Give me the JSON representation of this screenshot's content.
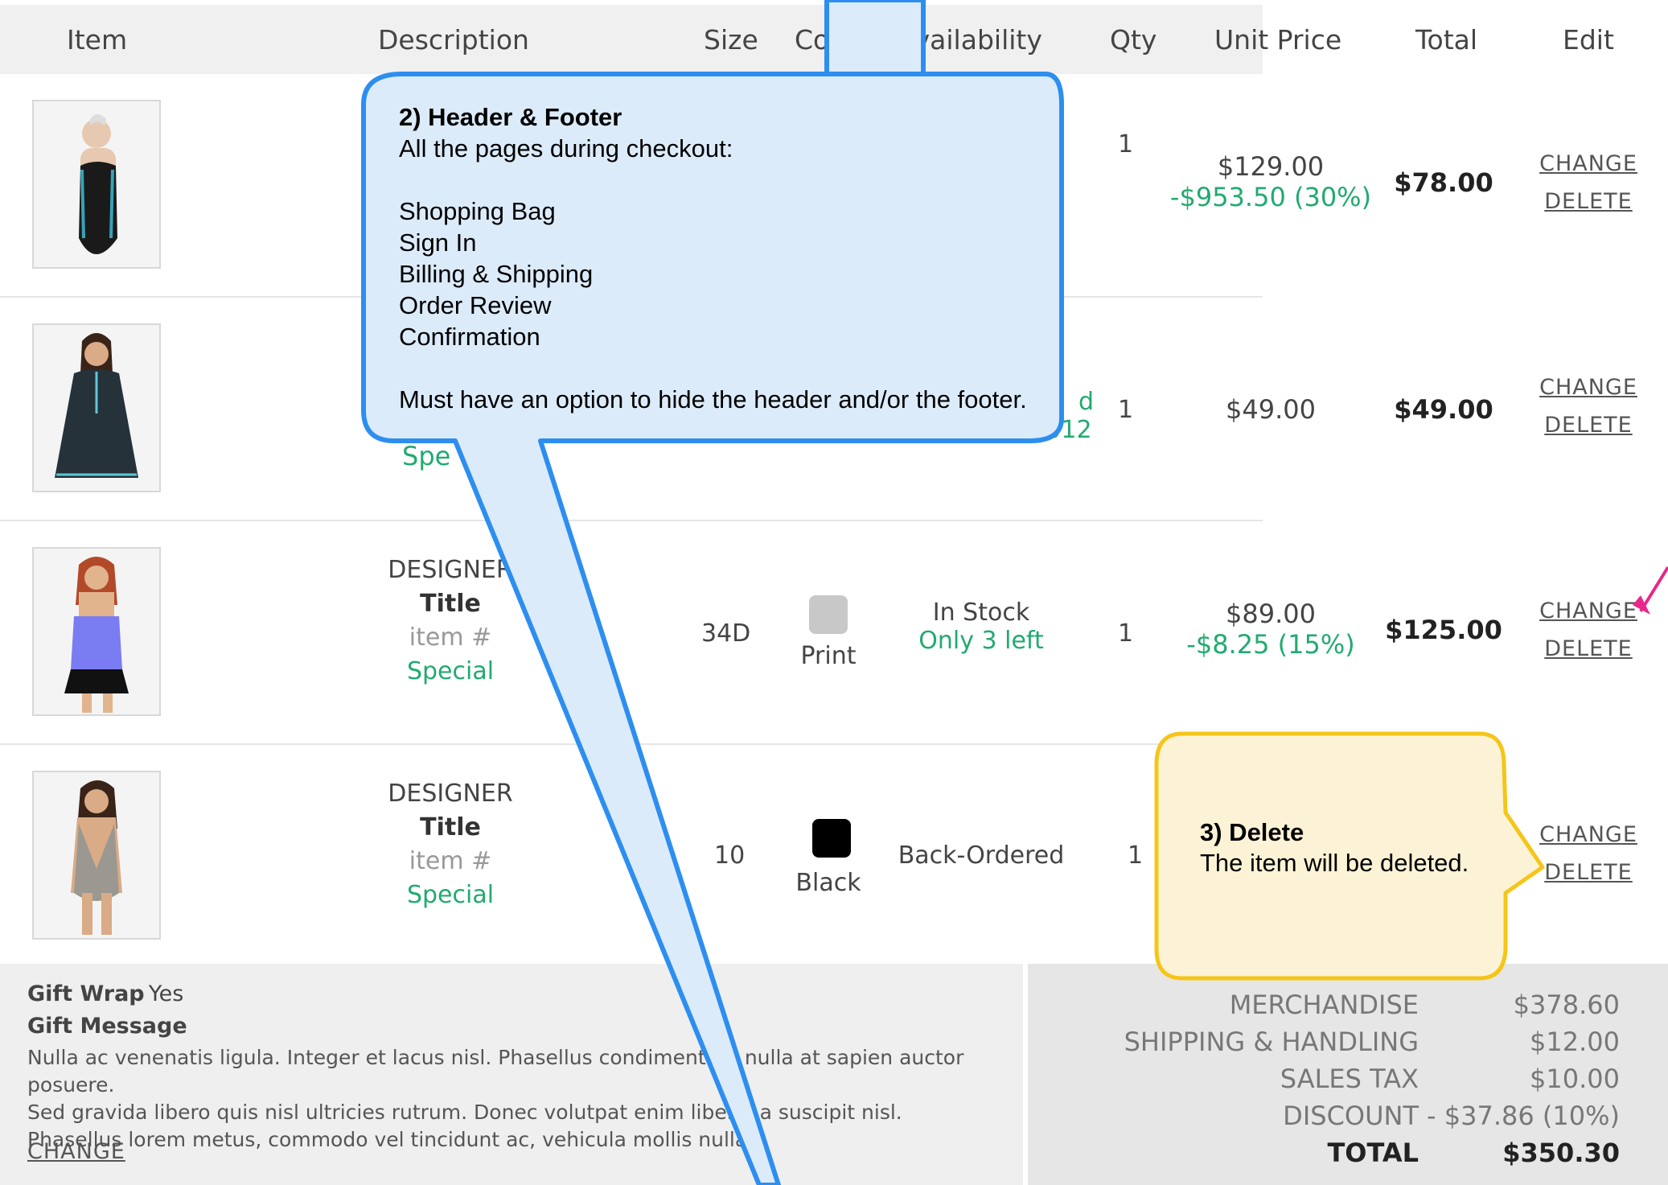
{
  "columns": [
    "Item",
    "Description",
    "Size",
    "Color",
    "Availability",
    "Qty",
    "Unit Price",
    "Total",
    "Edit"
  ],
  "rows": [
    {
      "designer": "",
      "title": "",
      "item_no": "",
      "special": "",
      "size": "",
      "color_name": "",
      "availability": "",
      "availability_note": "",
      "qty": "1",
      "unit_price": "$129.00",
      "discount": "-$953.50 (30%)",
      "total": "$78.00",
      "change": "CHANGE",
      "delete": "DELETE"
    },
    {
      "designer": "",
      "title": "",
      "item_no": "",
      "special": "Spe",
      "size": "",
      "color_name": "",
      "availability": "d",
      "availability_note": "On 11/11/2012",
      "qty": "1",
      "unit_price": "$49.00",
      "discount": "",
      "total": "$49.00",
      "change": "CHANGE",
      "delete": "DELETE"
    },
    {
      "designer": "DESIGNER",
      "title": "Title",
      "item_no": "item #",
      "special": "Special",
      "size": "34D",
      "color_name": "Print",
      "swatch": "#c8c8c8",
      "availability": "In Stock",
      "availability_note": "Only 3 left",
      "qty": "1",
      "unit_price": "$89.00",
      "discount": "-$8.25 (15%)",
      "total": "$125.00",
      "change": "CHANGE",
      "delete": "DELETE"
    },
    {
      "designer": "DESIGNER",
      "title": "Title",
      "item_no": "item #",
      "special": "Special",
      "size": "10",
      "color_name": "Black",
      "swatch": "#000000",
      "availability": "Back-Ordered",
      "availability_note": "",
      "qty": "1",
      "unit_price": "",
      "discount": "",
      "total": "",
      "change": "CHANGE",
      "delete": "DELETE"
    }
  ],
  "gift": {
    "wrap_label": "Gift Wrap",
    "wrap_value": "Yes",
    "message_label": "Gift Message",
    "message_lines": [
      "Nulla ac venenatis ligula. Integer et lacus nisl. Phasellus condimentum nulla at sapien auctor posuere.",
      "Sed gravida libero quis nisl ultricies rutrum. Donec volutpat enim libero, a suscipit nisl.",
      "Phasellus lorem metus, commodo vel tincidunt ac, vehicula mollis nulla."
    ],
    "change": "CHANGE"
  },
  "summary": {
    "merchandise_label": "MERCHANDISE",
    "merchandise": "$378.60",
    "shipping_label": "SHIPPING & HANDLING",
    "shipping": "$12.00",
    "tax_label": "SALES TAX",
    "tax": "$10.00",
    "discount_label": "DISCOUNT",
    "discount": "- $37.86 (10%)",
    "total_label": "TOTAL",
    "total": "$350.30"
  },
  "callout_header": {
    "title": "2) Header & Footer",
    "intro": "All the pages during checkout:",
    "pages": [
      "Shopping Bag",
      "Sign In",
      "Billing & Shipping",
      "Order Review",
      "Confirmation"
    ],
    "note": "Must have an option to hide the header and/or the footer."
  },
  "callout_delete": {
    "title": "3) Delete",
    "text": "The item will be deleted."
  },
  "colors": {
    "accent_green": "#22aa70",
    "callout_blue": "#2d8ef0",
    "callout_fill": "#dcebfa",
    "note_yellow": "#f5c518",
    "note_fill": "#fcf3d6",
    "arrow_pink": "#e8288a"
  }
}
